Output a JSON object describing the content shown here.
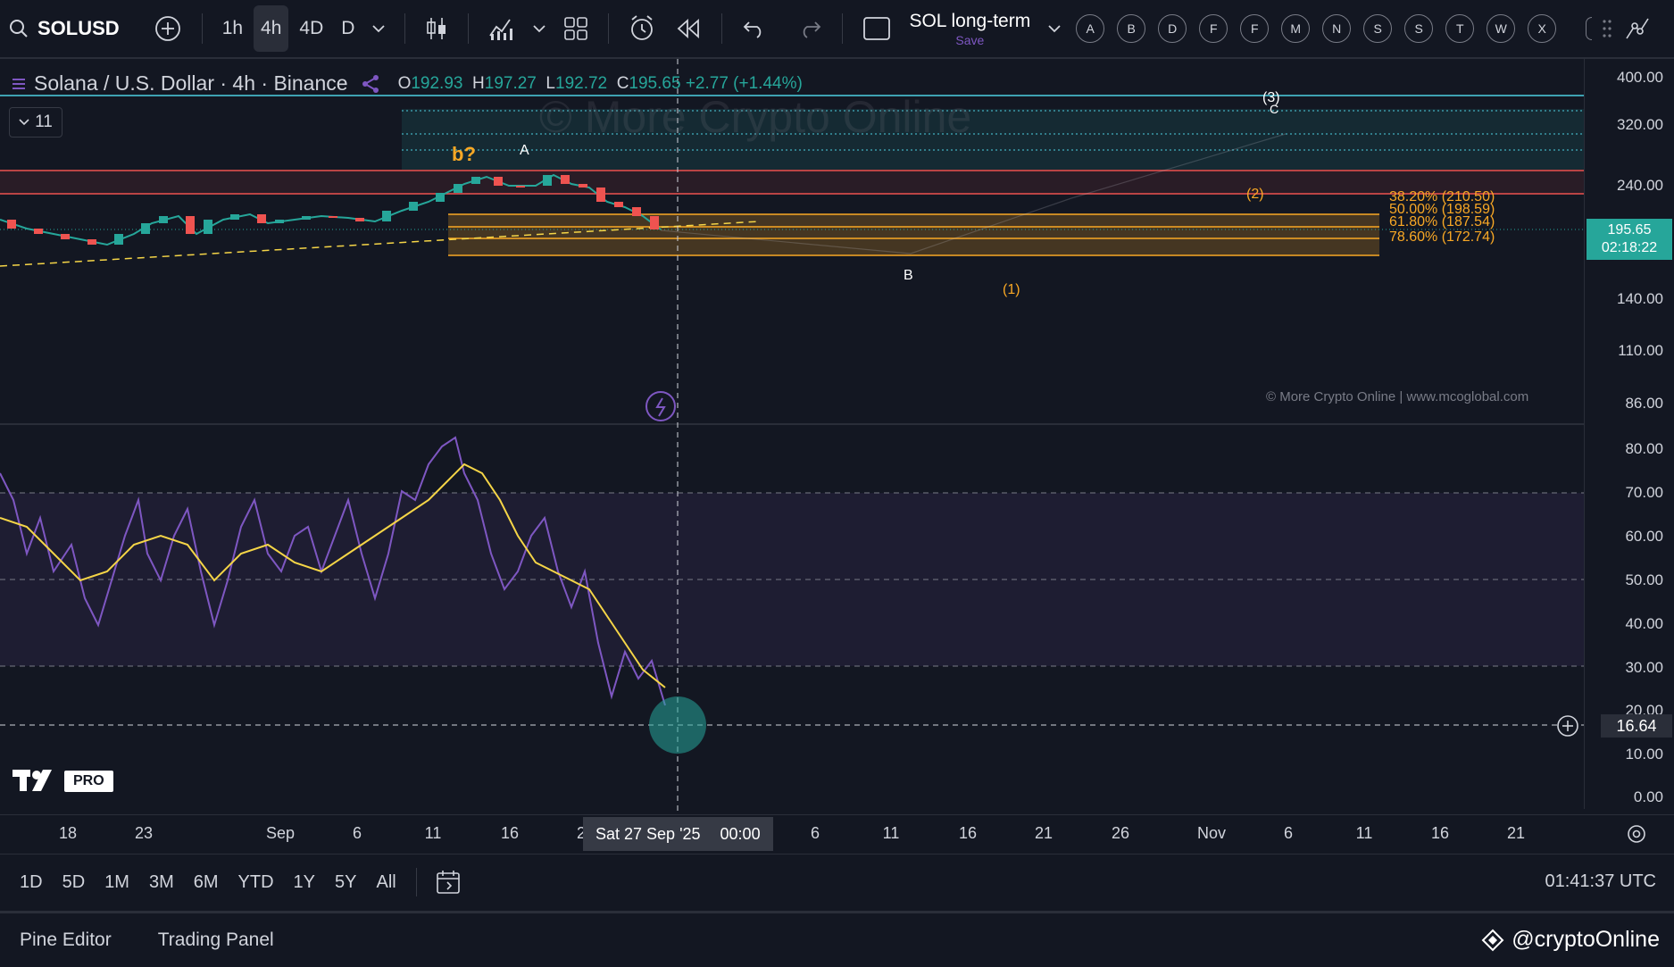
{
  "toolbar": {
    "symbol": "SOLUSD",
    "intervals": [
      "1h",
      "4h",
      "4D",
      "D"
    ],
    "active_interval": "4h",
    "layout_name": "SOL long-term",
    "layout_save": "Save",
    "quick_letters": [
      "A",
      "B",
      "D",
      "F",
      "F",
      "M",
      "N",
      "S",
      "S",
      "T",
      "W",
      "X"
    ]
  },
  "legend": {
    "title": "Solana / U.S. Dollar · 4h · Binance",
    "open": "192.93",
    "high": "197.27",
    "low": "192.72",
    "close": "195.65",
    "change": "+2.77 (+1.44%)",
    "collapse_count": "11"
  },
  "annotations": {
    "wave_b_q": "b?",
    "wave_a": "A",
    "wave_b": "B",
    "wave_1": "(1)",
    "wave_2": "(2)",
    "wave_3": "(3)",
    "wave_c": "C",
    "watermark": "© More Crypto Online",
    "watermark_small": "© More Crypto Online  |  www.mcoglobal.com",
    "fib_382": "38.20% (210.50)",
    "fib_500": "50.00% (198.59)",
    "fib_618": "61.80% (187.54)",
    "fib_786": "78.60% (172.74)"
  },
  "price_scale": {
    "ticks": [
      "400.00",
      "320.00",
      "240.00",
      "140.00",
      "110.00",
      "86.00"
    ],
    "last_price": "195.65",
    "countdown": "02:18:22"
  },
  "rsi_scale": {
    "ticks": [
      "80.00",
      "70.00",
      "60.00",
      "50.00",
      "40.00",
      "30.00",
      "20.00",
      "10.00",
      "0.00"
    ],
    "crosshair_value": "16.64"
  },
  "time_axis": {
    "ticks": [
      "18",
      "23",
      "Sep",
      "6",
      "11",
      "16",
      "2",
      "6",
      "11",
      "16",
      "21",
      "26",
      "Nov",
      "6",
      "11",
      "16",
      "21"
    ],
    "cursor_date": "Sat 27 Sep '25",
    "cursor_time": "00:00"
  },
  "range_bar": {
    "ranges": [
      "1D",
      "5D",
      "1M",
      "3M",
      "6M",
      "YTD",
      "1Y",
      "5Y",
      "All"
    ],
    "clock": "01:41:37 UTC"
  },
  "bottom_bar": {
    "tabs": [
      "Pine Editor",
      "Trading Panel"
    ],
    "credit": "@cryptoOnline"
  },
  "logo": {
    "pro": "PRO"
  },
  "colors": {
    "background": "#131722",
    "up": "#26a69a",
    "down": "#ef5350",
    "rsi": "#7e57c2",
    "rsi_ma": "#f5d547",
    "fib": "#f9a825"
  }
}
